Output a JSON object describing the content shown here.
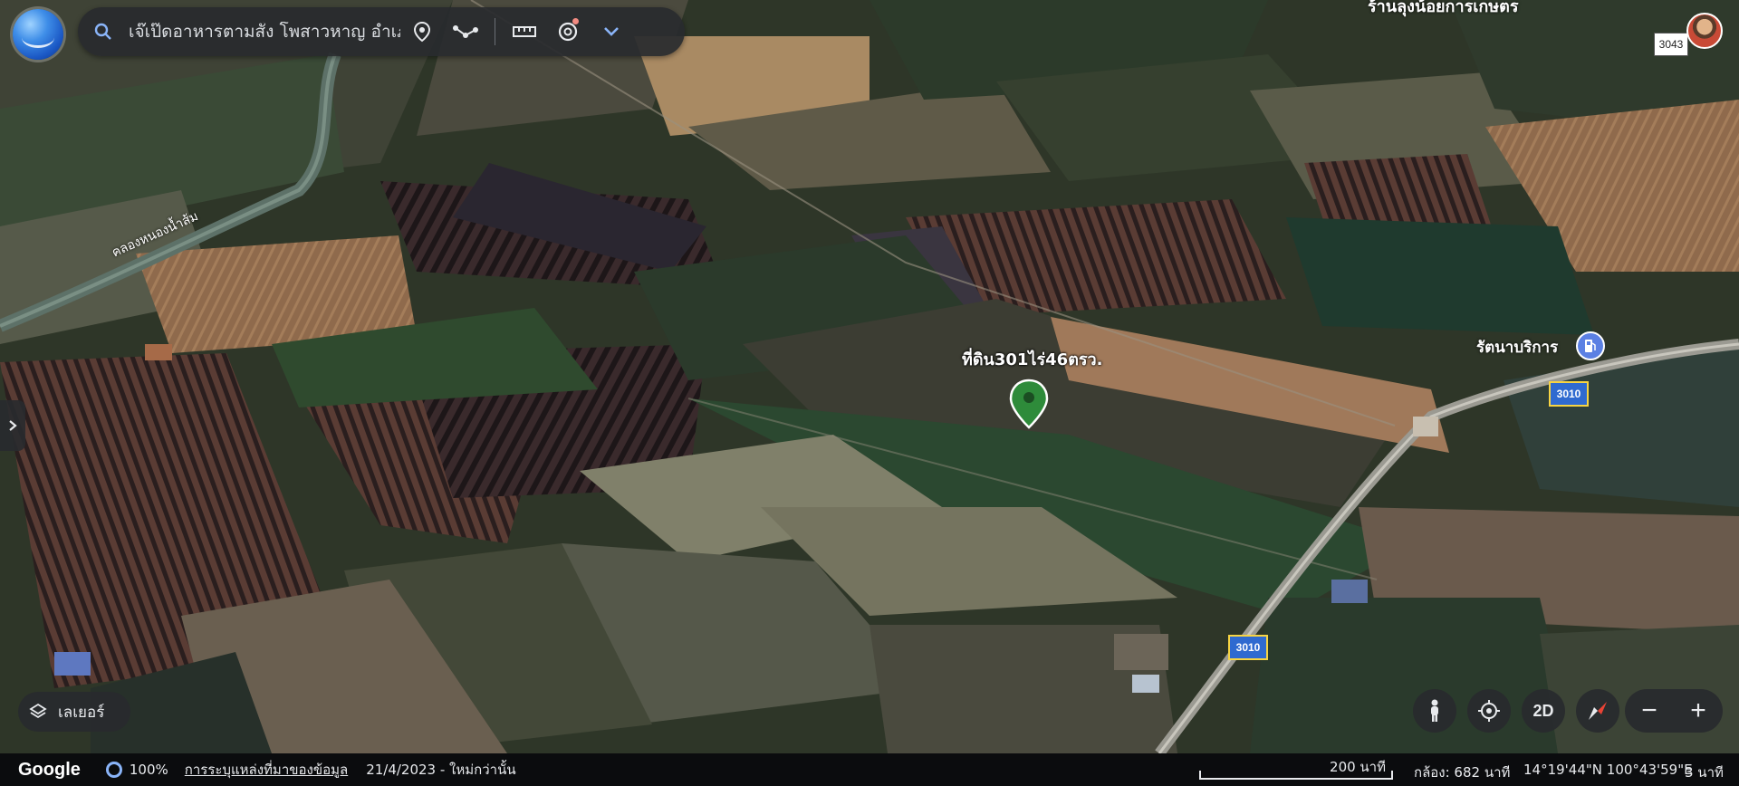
{
  "search": {
    "value": "เจ๊เป๊ดอาหารตามสั่ง โพสาวหาญ อำเภอ"
  },
  "toolbar": {
    "icons": [
      "search-icon",
      "location-pin-icon",
      "route-icon",
      "ruler-icon",
      "voyager-icon",
      "chevron-down-icon"
    ]
  },
  "header": {
    "top_right_place": "ร้านลุงน้อยการเกษตร",
    "route_number": "3043"
  },
  "map": {
    "pin_label": "ที่ดิน301ไร่46ตรว.",
    "place_label": "รัตนาบริการ",
    "canal_label": "คลองหนองน้ำส้ม",
    "road_shield_a": "3010",
    "road_shield_b": "3010"
  },
  "layers": {
    "label": "เลเยอร์"
  },
  "controls": {
    "view_mode": "2D"
  },
  "status": {
    "brand": "Google",
    "zoom": "100%",
    "data_link": "การระบุแหล่งที่มาของข้อมูล",
    "date": "21/4/2023 - ใหม่กว่านั้น",
    "scale": "200 นาที",
    "camera": "กล้อง: 682 นาที",
    "coordinates": "14°19'44\"N 100°43'59\"E",
    "elevation": "3 นาที"
  },
  "colors": {
    "pin_green": "#2e8b3a",
    "route_shield": "#2f6ad0",
    "accent": "#8ab4f8"
  }
}
